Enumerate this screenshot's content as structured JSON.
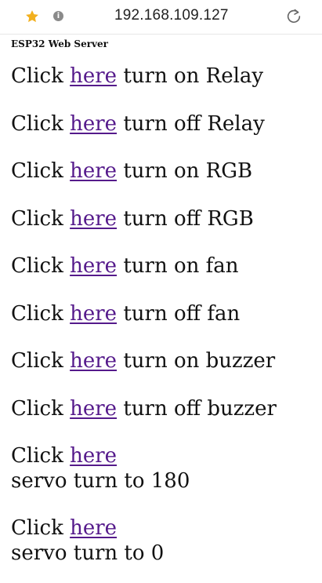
{
  "browser": {
    "address": "192.168.109.127",
    "info_glyph": "i",
    "icons": [
      "star-icon",
      "info-icon",
      "reload-icon"
    ],
    "star_color": "#f2b01e"
  },
  "page": {
    "heading": "ESP32 Web Server",
    "link_color": "#551a8b",
    "controls": [
      {
        "prefix": "Click ",
        "link": "here",
        "action": " turn on Relay"
      },
      {
        "prefix": "Click ",
        "link": "here",
        "action": " turn off Relay"
      },
      {
        "prefix": "Click ",
        "link": "here",
        "action": " turn on RGB"
      },
      {
        "prefix": "Click ",
        "link": "here",
        "action": " turn off RGB"
      },
      {
        "prefix": "Click ",
        "link": "here",
        "action": " turn on fan"
      },
      {
        "prefix": "Click ",
        "link": "here",
        "action": " turn off fan"
      },
      {
        "prefix": "Click ",
        "link": "here",
        "action": " turn on buzzer"
      },
      {
        "prefix": "Click ",
        "link": "here",
        "action": " turn off buzzer"
      },
      {
        "prefix": "Click ",
        "link": "here",
        "action": "servo turn to 180"
      },
      {
        "prefix": "Click ",
        "link": "here",
        "action": "servo turn to 0"
      }
    ]
  }
}
